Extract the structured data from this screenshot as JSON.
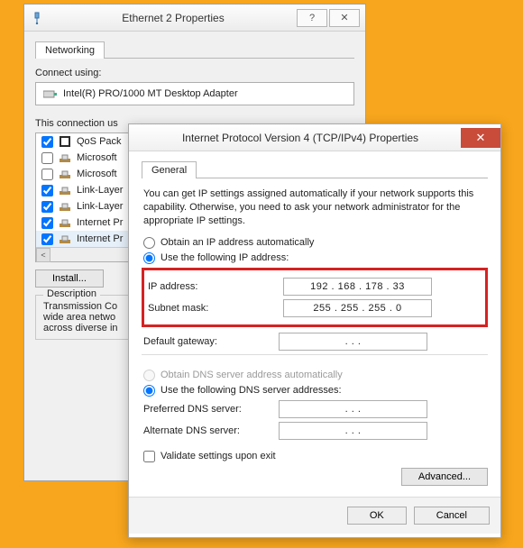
{
  "back": {
    "title": "Ethernet 2 Properties",
    "tab": "Networking",
    "connect_label": "Connect using:",
    "adapter": "Intel(R) PRO/1000 MT Desktop Adapter",
    "uses_label": "This connection us",
    "items": [
      {
        "checked": true,
        "label": "QoS Pack"
      },
      {
        "checked": false,
        "label": "Microsoft"
      },
      {
        "checked": false,
        "label": "Microsoft"
      },
      {
        "checked": true,
        "label": "Link-Layer"
      },
      {
        "checked": true,
        "label": "Link-Layer"
      },
      {
        "checked": true,
        "label": "Internet Pr"
      },
      {
        "checked": true,
        "label": "Internet Pr"
      }
    ],
    "install_btn": "Install...",
    "desc_legend": "Description",
    "desc_text": "Transmission Co\nwide area netwo\nacross diverse in"
  },
  "front": {
    "title": "Internet Protocol Version 4 (TCP/IPv4) Properties",
    "tab": "General",
    "info": "You can get IP settings assigned automatically if your network supports this capability. Otherwise, you need to ask your network administrator for the appropriate IP settings.",
    "radio_obtain_ip": "Obtain an IP address automatically",
    "radio_use_ip": "Use the following IP address:",
    "ip_label": "IP address:",
    "ip_value": "192 . 168 . 178 .  33",
    "subnet_label": "Subnet mask:",
    "subnet_value": "255 . 255 . 255 .   0",
    "gateway_label": "Default gateway:",
    "gateway_value": ".        .        .",
    "radio_obtain_dns": "Obtain DNS server address automatically",
    "radio_use_dns": "Use the following DNS server addresses:",
    "pref_dns_label": "Preferred DNS server:",
    "pref_dns_value": ".        .        .",
    "alt_dns_label": "Alternate DNS server:",
    "alt_dns_value": ".        .        .",
    "validate_label": "Validate settings upon exit",
    "advanced_btn": "Advanced...",
    "ok_btn": "OK",
    "cancel_btn": "Cancel"
  }
}
